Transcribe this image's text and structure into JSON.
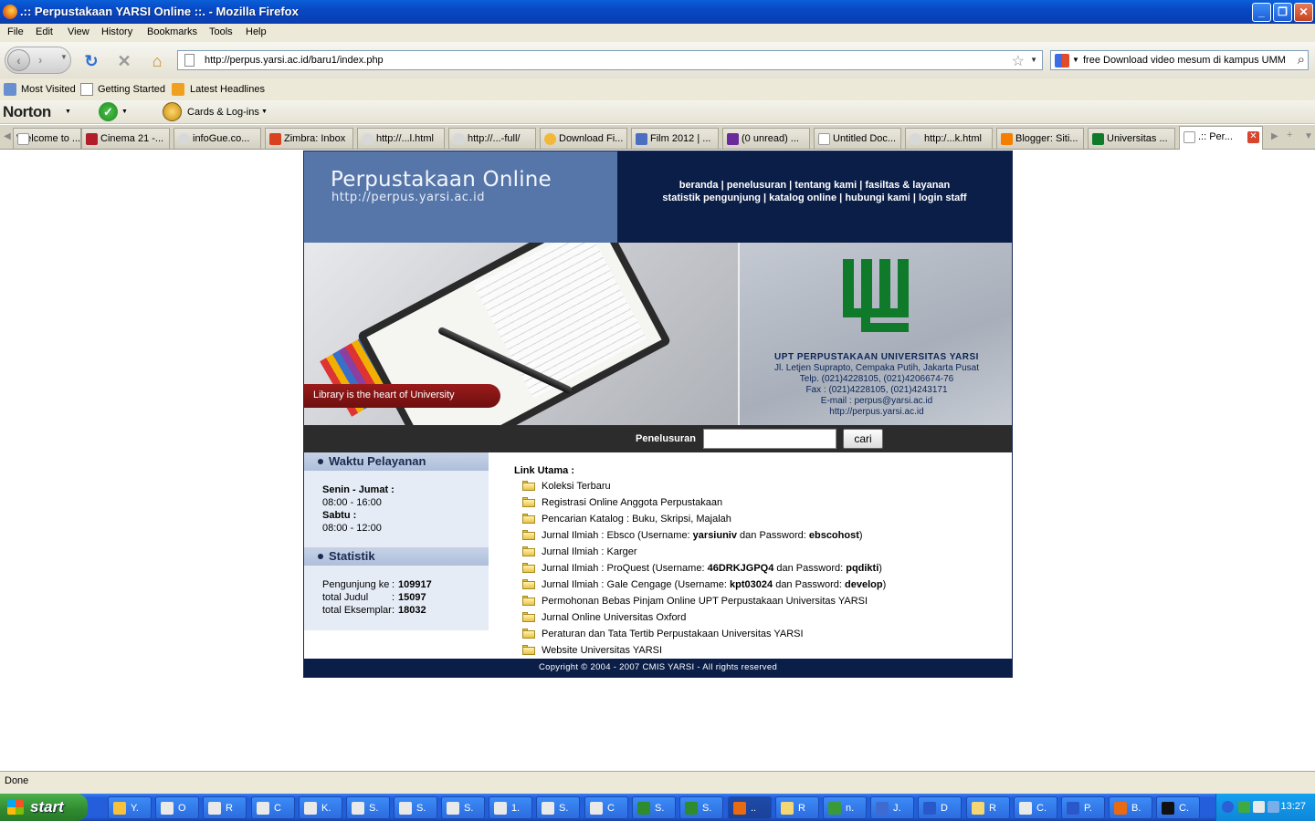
{
  "window": {
    "title": ".:: Perpustakaan YARSI Online ::. - Mozilla Firefox",
    "controls": {
      "minimize": "_",
      "restore": "❐",
      "close": "✕"
    }
  },
  "menu": [
    "File",
    "Edit",
    "View",
    "History",
    "Bookmarks",
    "Tools",
    "Help"
  ],
  "nav": {
    "url": "http://perpus.yarsi.ac.id/baru1/index.php",
    "search_text": "free Download video mesum di kampus UMM"
  },
  "bookmarks": [
    "Most Visited",
    "Getting Started",
    "Latest Headlines"
  ],
  "norton": {
    "brand": "Norton",
    "cards": "Cards & Log-ins"
  },
  "tabs": [
    "Welcome to ...",
    "Cinema 21 -...",
    "infoGue.co...",
    "Zimbra: Inbox",
    "http://...l.html",
    "http://...-full/",
    "Download Fi...",
    "Film 2012 | ...",
    "(0 unread) ...",
    "Untitled Doc...",
    "http:/...k.html",
    "Blogger: Siti...",
    "Universitas ...",
    ".:: Per..."
  ],
  "site": {
    "header_title": "Perpustakaan Online",
    "header_url": "http://perpus.yarsi.ac.id",
    "nav_line1": "beranda | penelusuran | tentang kami | fasiltas & layanan",
    "nav_line2": "statistik pengunjung | katalog online | hubungi kami | login staff",
    "tagline": "Library is the heart of University",
    "org_name": "UPT PERPUSTAKAAN UNIVERSITAS YARSI",
    "address": [
      "Jl. Letjen Suprapto, Cempaka Putih, Jakarta Pusat",
      "Telp. (021)4228105, (021)4206674-76",
      "Fax : (021)4228105, (021)4243171",
      "E-mail : perpus@yarsi.ac.id",
      "http://perpus.yarsi.ac.id"
    ],
    "search_label": "Penelusuran",
    "search_button": "cari",
    "hours_title": "Waktu Pelayanan",
    "hours": {
      "weekday_label": "Senin - Jumat :",
      "weekday_time": "08:00 - 16:00",
      "sat_label": "Sabtu :",
      "sat_time": "08:00 - 12:00"
    },
    "stats_title": "Statistik",
    "stats": [
      {
        "label": "Pengunjung ke",
        "value": "109917"
      },
      {
        "label": "total Judul",
        "value": "15097"
      },
      {
        "label": "total Eksemplar",
        "value": "18032"
      }
    ],
    "links_heading": "Link Utama :",
    "links": [
      "Koleksi Terbaru",
      "Registrasi Online Anggota Perpustakaan",
      "Pencarian Katalog : Buku, Skripsi, Majalah",
      "Jurnal Ilmiah : Ebsco (Username: <b>yarsiuniv</b> dan Password: <b>ebscohost</b>)",
      "Jurnal Ilmiah : Karger",
      "Jurnal Ilmiah : ProQuest (Username: <b>46DRKJGPQ4</b> dan Password: <b>pqdikti</b>)",
      "Jurnal Ilmiah : Gale Cengage (Username: <b>kpt03024</b> dan Password: <b>develop</b>)",
      "Permohonan Bebas Pinjam Online UPT Perpustakaan Universitas YARSI",
      "Jurnal Online Universitas Oxford",
      "Peraturan dan Tata Tertib Perpustakaan Universitas YARSI",
      "Website Universitas YARSI"
    ],
    "footer": "Copyright © 2004 - 2007 CMIS YARSI - All rights reserved"
  },
  "status": "Done",
  "taskbar": {
    "start": "start",
    "items": [
      "Y.",
      "O",
      "R",
      "C",
      "K.",
      "S.",
      "S.",
      "S.",
      "1.",
      "S.",
      "C",
      "S.",
      "S.",
      "..",
      "R",
      "n.",
      "J.",
      "D",
      "R",
      "C.",
      "P.",
      "B.",
      "C."
    ],
    "clock": "13:27"
  }
}
